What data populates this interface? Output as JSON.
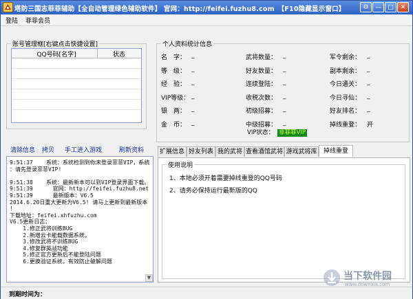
{
  "window": {
    "title": "塔防三国志菲菲辅助【全自动管理绿色辅助软件】 官网：http://feifei.fuzhu8.com　【F10隐藏显示窗口】",
    "buttons": {
      "settings": "⚙",
      "minimize": "—",
      "maximize": "□",
      "close": "✕"
    }
  },
  "menu": {
    "login": "登陆",
    "vip": "菲菲会员"
  },
  "accounts": {
    "group_title": "账号管理框[右键点击快捷设置]",
    "columns": [
      "QQ号码[名字]",
      "状态"
    ],
    "rows": []
  },
  "actions": {
    "clear_log": "清除信息",
    "copy": "拷贝",
    "manual_enter": "手工进入游戏",
    "refresh": "刷新资料"
  },
  "log_lines": [
    "9:51:37    系统：系统检测到你未登录菲菲VIP，系统",
    "：请先登录菲菲VIP!",
    "",
    "9:51:38    系统：最新新本可以到VIP登录界面下载。",
    "9:51:39      官网：http://feifei.fuzhu8.net",
    "9:51:39      最新版本：V6.5",
    "2014.6.20日重大更新为V6.5! 请马上更新到最新版本",
    "!",
    "下载地址：feifei.xhfuzhu.com",
    "V6.5更新日志：",
    "    1.修正武将训练BUG",
    "    2.新增云卡能载数据系统，",
    "    3.修改武将不训练BUG",
    "    4.修复群英战功能",
    "    5.修正官方更新后不能登陆问题",
    "    6.更换验证系统，有效防止破解问题"
  ],
  "profile": {
    "group_title": "个人资料统计信息",
    "col1": [
      {
        "label": "名　字：",
        "value": "_"
      },
      {
        "label": "等　级：",
        "value": "_"
      },
      {
        "label": "经　验：",
        "value": "_"
      },
      {
        "label": "VIP等级：",
        "value": "_"
      },
      {
        "label": "银　两：",
        "value": "_"
      },
      {
        "label": "金　币：",
        "value": "_"
      }
    ],
    "col2": [
      {
        "label": "武将数量：",
        "value": "_"
      },
      {
        "label": "好友数量：",
        "value": "_"
      },
      {
        "label": "连续登陆：",
        "value": "_"
      },
      {
        "label": "收税次数：",
        "value": "_"
      },
      {
        "label": "初级招募：",
        "value": "_"
      },
      {
        "label": "中级招募：",
        "value": "_"
      }
    ],
    "col3": [
      {
        "label": "军令剩余：",
        "value": "_"
      },
      {
        "label": "副本剩余：",
        "value": "_"
      },
      {
        "label": "今日通关：",
        "value": "_"
      },
      {
        "label": "今日寻仙：",
        "value": "_"
      },
      {
        "label": "好友排名：",
        "value": "_"
      },
      {
        "label": "掉线重登：",
        "value": "开"
      }
    ],
    "vip_status_label": "VIP状态：",
    "vip_status_value": "非菲菲VIP"
  },
  "tabs": [
    "扩展信息",
    "好友列表",
    "我的武将",
    "查看酒馆武将",
    "游戏武将库",
    "掉线重登"
  ],
  "active_tab": "掉线重登",
  "help": {
    "title": "使用说明",
    "lines": [
      "1、本地必须开着需要掉线重登的QQ号码",
      "2、请务必保持运行最新版的QQ"
    ]
  },
  "status": {
    "expiry_label": "到期时间为："
  },
  "watermark": {
    "text": "当下软件园",
    "sub": "www.downxia.com"
  },
  "colors": {
    "titlebar": "#2f63c4",
    "link": "#1a2fa6",
    "vip_value_bg": "#0f8a1c",
    "vip_value_fg": "#d8ff3a"
  }
}
